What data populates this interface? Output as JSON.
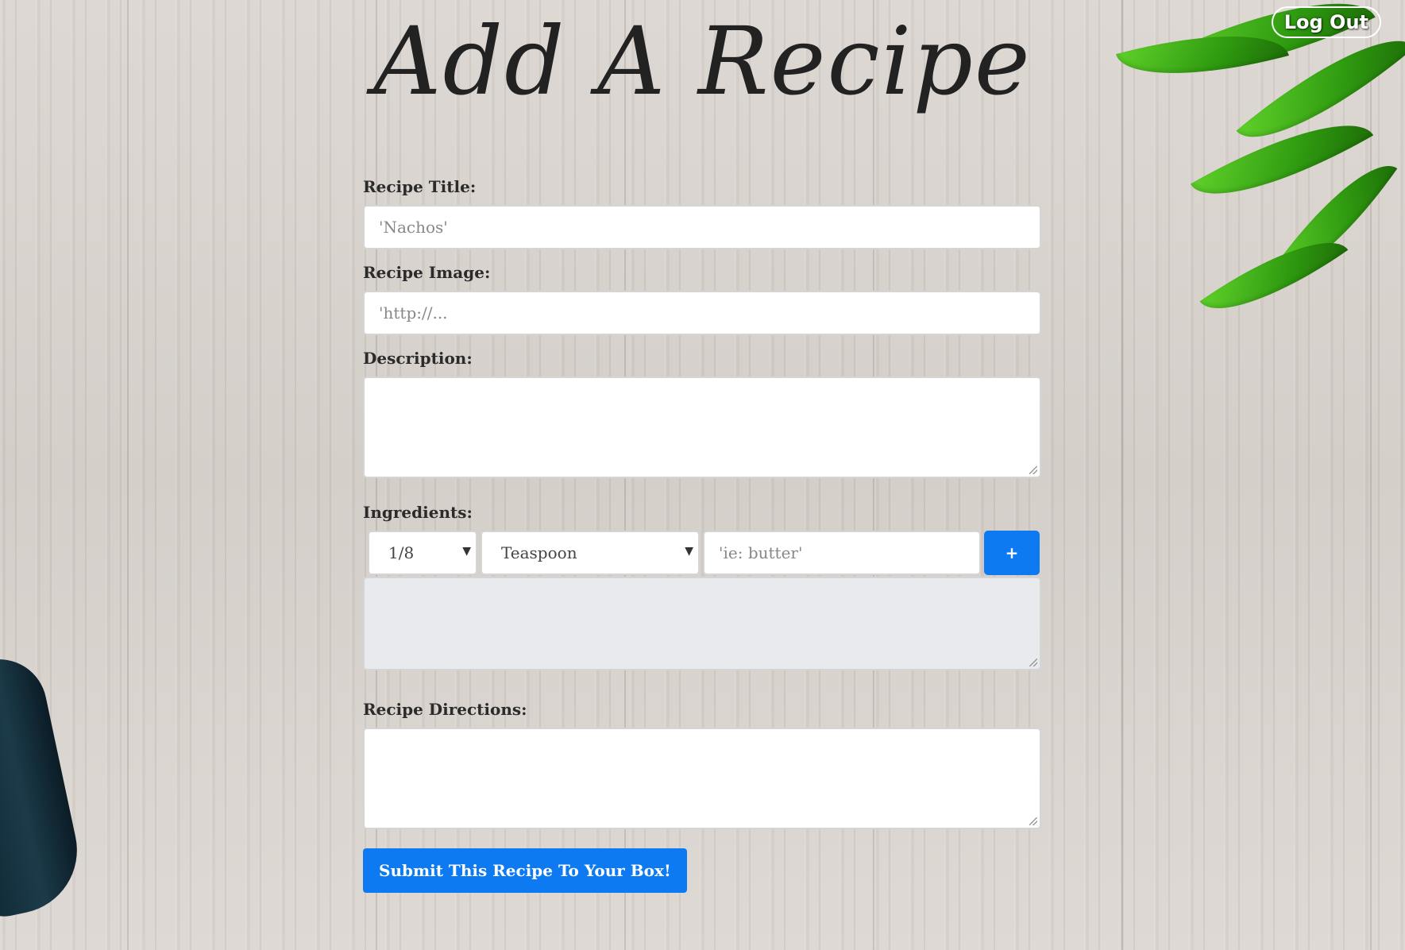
{
  "header": {
    "title": "Add A Recipe",
    "logout_label": "Log Out"
  },
  "form": {
    "title_label": "Recipe Title:",
    "title_placeholder": "'Nachos'",
    "image_label": "Recipe Image:",
    "image_placeholder": "'http://...",
    "description_label": "Description:",
    "description_value": "",
    "ingredients_label": "Ingredients:",
    "quantity_selected": "1/8",
    "unit_selected": "Teaspoon",
    "ingredient_placeholder": "'ie: butter'",
    "add_label": "+",
    "directions_label": "Recipe Directions:",
    "directions_value": "",
    "submit_label": "Submit This Recipe To Your Box!"
  },
  "colors": {
    "accent": "#0d7af2",
    "text": "#2b2b2b"
  },
  "icons": {
    "select_caret": "caret-down-icon",
    "add": "plus-icon"
  }
}
